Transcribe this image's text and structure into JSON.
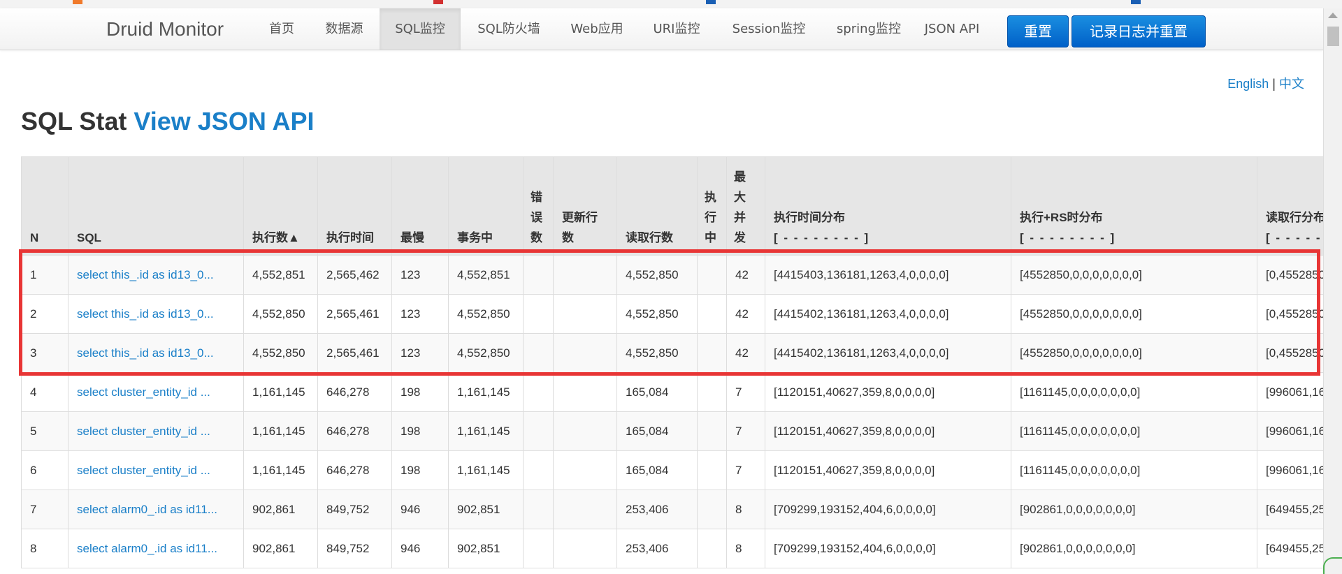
{
  "navbar": {
    "brand": "Druid Monitor",
    "items": [
      "首页",
      "数据源",
      "SQL监控",
      "SQL防火墙",
      "Web应用",
      "URI监控",
      "Session监控",
      "spring监控",
      "JSON API"
    ],
    "active_index": 2,
    "reset_button": "重置",
    "log_reset_button": "记录日志并重置"
  },
  "lang": {
    "english": "English",
    "sep": "|",
    "chinese": "中文"
  },
  "title": {
    "prefix": "SQL Stat",
    "link": "View JSON API"
  },
  "table": {
    "headers": {
      "n": "N",
      "sql": "SQL",
      "exec_count": "执行数▲",
      "exec_time": "执行时间",
      "slowest": "最慢",
      "in_tx": "事务中",
      "errors": [
        "错",
        "误",
        "数"
      ],
      "update_rows": [
        "更新行",
        "数"
      ],
      "read_rows": "读取行数",
      "running": [
        "执",
        "行",
        "中"
      ],
      "max_concurrent": [
        "最",
        "大",
        "并",
        "发"
      ],
      "exec_hist": "执行时间分布",
      "exec_hist_sub": "[ - - - - - - - - ]",
      "exec_rs_hist": "执行+RS时分布",
      "exec_rs_hist_sub": "[ - - - - - - - - ]",
      "read_hist": "读取行分布",
      "read_hist_sub": "[ - - - - - - ]"
    },
    "rows": [
      {
        "n": "1",
        "sql": "select this_.id as id13_0...",
        "exec_count": "4,552,851",
        "exec_time": "2,565,462",
        "slowest": "123",
        "in_tx": "4,552,851",
        "errors": "",
        "update_rows": "",
        "read_rows": "4,552,850",
        "running": "",
        "max_concurrent": "42",
        "exec_hist": "[4415403,136181,1263,4,0,0,0,0]",
        "exec_rs_hist": "[4552850,0,0,0,0,0,0,0]",
        "read_hist": "[0,4552850"
      },
      {
        "n": "2",
        "sql": "select this_.id as id13_0...",
        "exec_count": "4,552,850",
        "exec_time": "2,565,461",
        "slowest": "123",
        "in_tx": "4,552,850",
        "errors": "",
        "update_rows": "",
        "read_rows": "4,552,850",
        "running": "",
        "max_concurrent": "42",
        "exec_hist": "[4415402,136181,1263,4,0,0,0,0]",
        "exec_rs_hist": "[4552850,0,0,0,0,0,0,0]",
        "read_hist": "[0,4552850"
      },
      {
        "n": "3",
        "sql": "select this_.id as id13_0...",
        "exec_count": "4,552,850",
        "exec_time": "2,565,461",
        "slowest": "123",
        "in_tx": "4,552,850",
        "errors": "",
        "update_rows": "",
        "read_rows": "4,552,850",
        "running": "",
        "max_concurrent": "42",
        "exec_hist": "[4415402,136181,1263,4,0,0,0,0]",
        "exec_rs_hist": "[4552850,0,0,0,0,0,0,0]",
        "read_hist": "[0,4552850"
      },
      {
        "n": "4",
        "sql": "select cluster_entity_id ...",
        "exec_count": "1,161,145",
        "exec_time": "646,278",
        "slowest": "198",
        "in_tx": "1,161,145",
        "errors": "",
        "update_rows": "",
        "read_rows": "165,084",
        "running": "",
        "max_concurrent": "7",
        "exec_hist": "[1120151,40627,359,8,0,0,0,0]",
        "exec_rs_hist": "[1161145,0,0,0,0,0,0,0]",
        "read_hist": "[996061,16"
      },
      {
        "n": "5",
        "sql": "select cluster_entity_id ...",
        "exec_count": "1,161,145",
        "exec_time": "646,278",
        "slowest": "198",
        "in_tx": "1,161,145",
        "errors": "",
        "update_rows": "",
        "read_rows": "165,084",
        "running": "",
        "max_concurrent": "7",
        "exec_hist": "[1120151,40627,359,8,0,0,0,0]",
        "exec_rs_hist": "[1161145,0,0,0,0,0,0,0]",
        "read_hist": "[996061,16"
      },
      {
        "n": "6",
        "sql": "select cluster_entity_id ...",
        "exec_count": "1,161,145",
        "exec_time": "646,278",
        "slowest": "198",
        "in_tx": "1,161,145",
        "errors": "",
        "update_rows": "",
        "read_rows": "165,084",
        "running": "",
        "max_concurrent": "7",
        "exec_hist": "[1120151,40627,359,8,0,0,0,0]",
        "exec_rs_hist": "[1161145,0,0,0,0,0,0,0]",
        "read_hist": "[996061,16"
      },
      {
        "n": "7",
        "sql": "select alarm0_.id as id11...",
        "exec_count": "902,861",
        "exec_time": "849,752",
        "slowest": "946",
        "in_tx": "902,851",
        "errors": "",
        "update_rows": "",
        "read_rows": "253,406",
        "running": "",
        "max_concurrent": "8",
        "exec_hist": "[709299,193152,404,6,0,0,0,0]",
        "exec_rs_hist": "[902861,0,0,0,0,0,0,0]",
        "read_hist": "[649455,25"
      },
      {
        "n": "8",
        "sql": "select alarm0_.id as id11...",
        "exec_count": "902,861",
        "exec_time": "849,752",
        "slowest": "946",
        "in_tx": "902,851",
        "errors": "",
        "update_rows": "",
        "read_rows": "253,406",
        "running": "",
        "max_concurrent": "8",
        "exec_hist": "[709299,193152,404,6,0,0,0,0]",
        "exec_rs_hist": "[902861,0,0,0,0,0,0,0]",
        "read_hist": "[649455,25"
      }
    ]
  },
  "colors": {
    "link": "#1a7fc8",
    "primary_button": "#0a6fd4",
    "highlight": "#e83535"
  },
  "icons": [
    "scroll-up-arrow-icon"
  ]
}
